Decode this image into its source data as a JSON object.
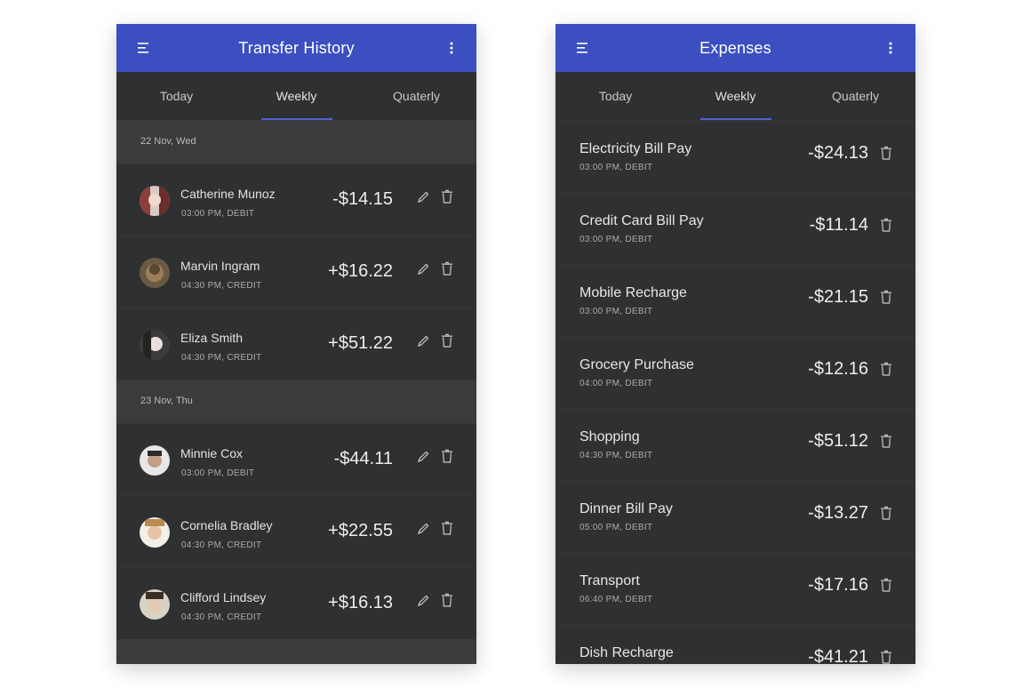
{
  "colors": {
    "appbar": "#3b4fc0",
    "background": "#2f3032",
    "date_header": "#3a3b3d",
    "tab_indicator": "#4f63d8",
    "text_primary": "#e1e2e4",
    "text_secondary": "#a9aaac"
  },
  "icons": {
    "menu": "menu-icon",
    "more": "more-vert-icon",
    "edit": "pencil-icon",
    "delete": "trash-icon"
  },
  "transfer": {
    "title": "Transfer History",
    "tabs": [
      {
        "label": "Today",
        "active": false
      },
      {
        "label": "Weekly",
        "active": true
      },
      {
        "label": "Quaterly",
        "active": false
      }
    ],
    "groups": [
      {
        "date": "22 Nov, Wed",
        "items": [
          {
            "name": "Catherine Munoz",
            "meta": "03:00 PM, DEBIT",
            "amount": "-$14.15"
          },
          {
            "name": "Marvin Ingram",
            "meta": "04:30 PM, CREDIT",
            "amount": "+$16.22"
          },
          {
            "name": "Eliza Smith",
            "meta": "04:30 PM, CREDIT",
            "amount": "+$51.22"
          }
        ]
      },
      {
        "date": "23 Nov, Thu",
        "items": [
          {
            "name": "Minnie Cox",
            "meta": "03:00 PM, DEBIT",
            "amount": "-$44.11"
          },
          {
            "name": "Cornelia Bradley",
            "meta": "04:30 PM, CREDIT",
            "amount": "+$22.55"
          },
          {
            "name": "Clifford Lindsey",
            "meta": "04:30 PM, CREDIT",
            "amount": "+$16.13"
          }
        ]
      }
    ]
  },
  "expenses": {
    "title": "Expenses",
    "tabs": [
      {
        "label": "Today",
        "active": false
      },
      {
        "label": "Weekly",
        "active": true
      },
      {
        "label": "Quaterly",
        "active": false
      }
    ],
    "items": [
      {
        "name": "Electricity Bill Pay",
        "meta": "03:00 PM, DEBIT",
        "amount": "-$24.13"
      },
      {
        "name": "Credit Card Bill Pay",
        "meta": "03:00 PM, DEBIT",
        "amount": "-$11.14"
      },
      {
        "name": "Mobile Recharge",
        "meta": "03:00 PM, DEBIT",
        "amount": "-$21.15"
      },
      {
        "name": "Grocery Purchase",
        "meta": "04:00 PM, DEBIT",
        "amount": "-$12.16"
      },
      {
        "name": "Shopping",
        "meta": "04:30 PM, DEBIT",
        "amount": "-$51.12"
      },
      {
        "name": "Dinner Bill Pay",
        "meta": "05:00 PM, DEBIT",
        "amount": "-$13.27"
      },
      {
        "name": "Transport",
        "meta": "06:40 PM, DEBIT",
        "amount": "-$17.16"
      },
      {
        "name": "Dish Recharge",
        "meta": "",
        "amount": "-$41.21"
      }
    ]
  }
}
